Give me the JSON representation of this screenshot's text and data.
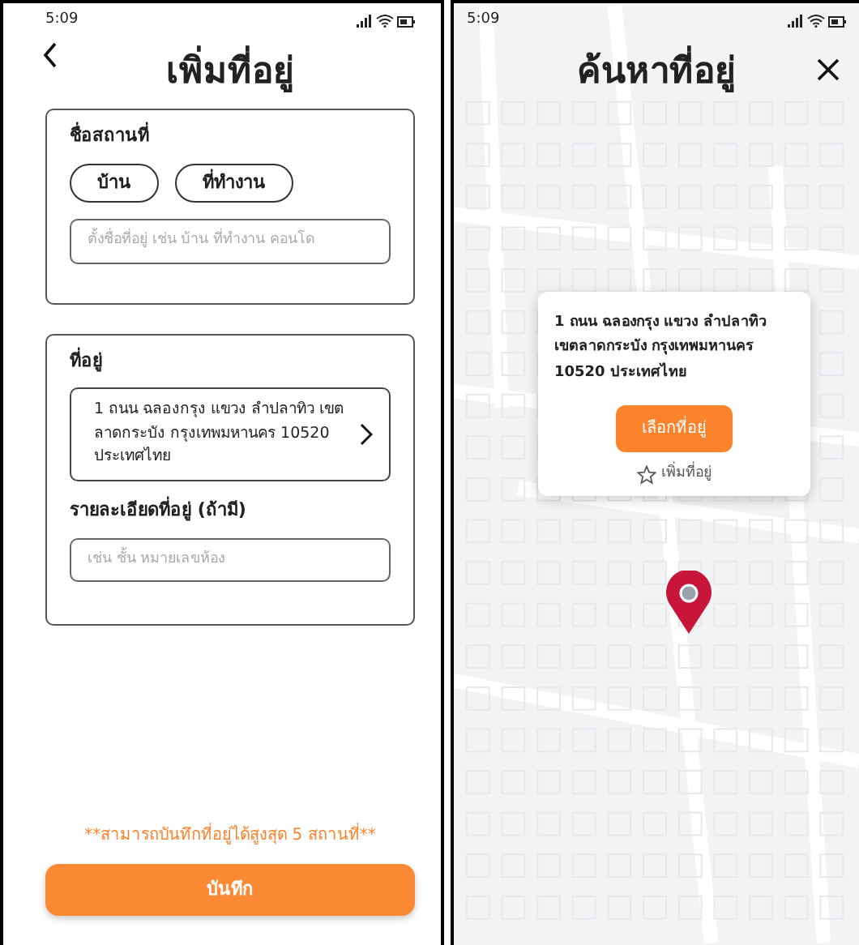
{
  "add_address_screen": {
    "status_time": "5:09",
    "title": "เพิ่มที่อยู่",
    "place_section": {
      "label": "ชื่อสถานที่",
      "chips": [
        {
          "label": "บ้าน",
          "selected": false
        },
        {
          "label": "ที่ทำงาน",
          "selected": false
        }
      ],
      "name_field": {
        "placeholder": "ตั้งชื่อที่อยู่ เช่น บ้าน ที่ทำงาน คอนโด"
      }
    },
    "address_section": {
      "label": "ที่อยู่",
      "address": "1 ถนน ฉลองกรุง แขวง ลำปลาทิว เขตลาดกระบัง กรุงเทพมหานคร 10520 ประเทศไทย",
      "detail_label": "รายละเอียดที่อยู่ (ถ้ามี)",
      "detail_field": {
        "placeholder": "เช่น ชั้น หมายเลขห้อง"
      }
    },
    "note": "**สามารถบันทึกที่อยู่ได้สูงสุด 5 สถานที่**",
    "save_button": "บันทึก"
  },
  "search_address_screen": {
    "status_time": "5:09",
    "title": "ค้นหาที่อยู่",
    "popup": {
      "address": "1 ถนน ฉลองกรุง แขวง ลำปลาทิว เขตลาดกระบัง กรุงเทพมหานคร 10520 ประเทศไทย",
      "select_button": "เลือกที่อยู่",
      "add_link": "เพิ่มที่อยู่"
    }
  }
}
